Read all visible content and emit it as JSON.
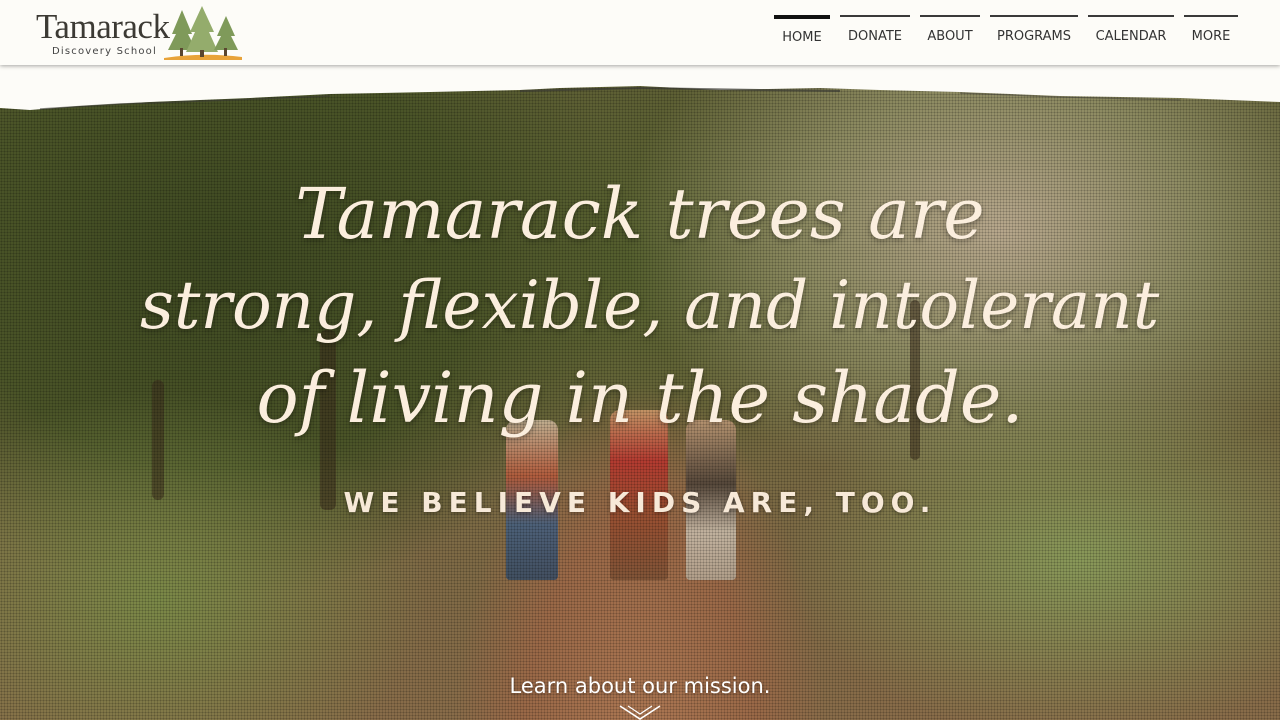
{
  "logo": {
    "word": "Tamarack",
    "subtitle": "Discovery School"
  },
  "nav": {
    "items": [
      {
        "label": "HOME"
      },
      {
        "label": "DONATE"
      },
      {
        "label": "ABOUT"
      },
      {
        "label": "PROGRAMS"
      },
      {
        "label": "CALENDAR"
      },
      {
        "label": "MORE"
      }
    ],
    "active": "HOME"
  },
  "hero": {
    "headline_lines": [
      "Tamarack trees are",
      "strong, flexible, and intolerant",
      "of living in the shade."
    ],
    "tagline": "WE BELIEVE KIDS ARE, TOO.",
    "cta": "Learn about our mission.",
    "cta_icon": "chevron-down-icon"
  },
  "colors": {
    "header_bg": "#fdfcf8",
    "headline": "#fbeede",
    "nav_text": "#333333",
    "logo_orange": "#e8a33a",
    "logo_green": "#7f9a5a"
  }
}
